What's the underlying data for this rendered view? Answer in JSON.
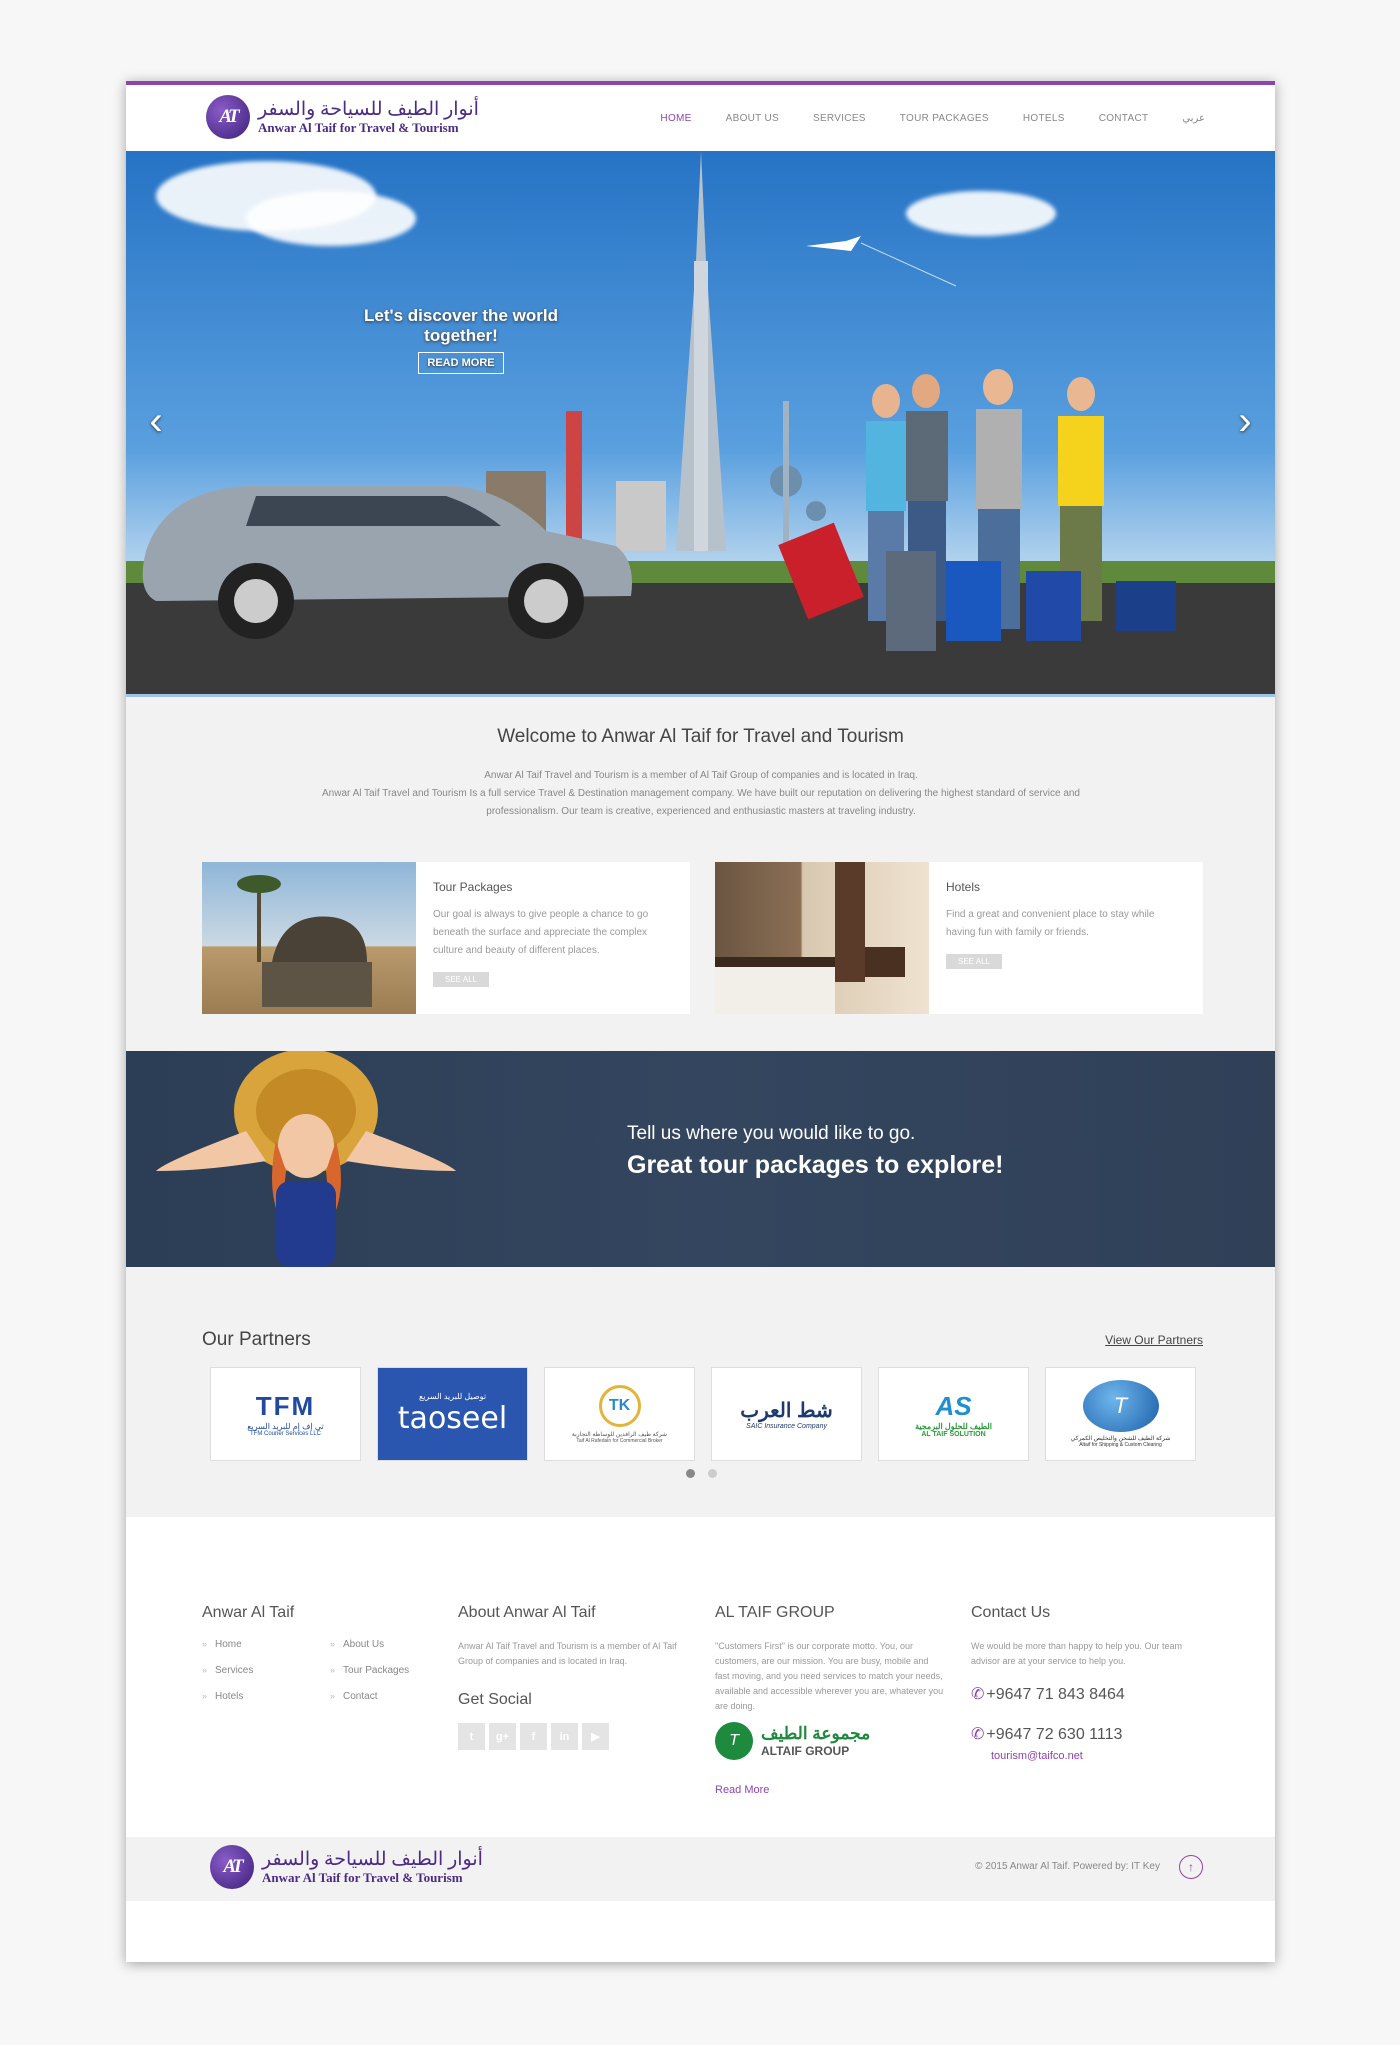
{
  "header": {
    "logo_initials": "AT",
    "logo_arabic": "أنوار الطيف للسياحة والسفر",
    "logo_english": "Anwar Al Taif for Travel & Tourism",
    "nav": [
      "HOME",
      "ABOUT US",
      "SERVICES",
      "TOUR PACKAGES",
      "HOTELS",
      "CONTACT",
      "عربي"
    ]
  },
  "hero": {
    "caption": "Let's discover the world together!",
    "button": "READ MORE",
    "prev_icon": "‹",
    "next_icon": "›"
  },
  "welcome": {
    "title": "Welcome to Anwar Al Taif for Travel and Tourism",
    "line1": "Anwar Al Taif Travel and Tourism is a member of Al Taif Group of companies and is located in Iraq.",
    "line2": "Anwar Al Taif Travel and Tourism Is a full service Travel & Destination management company. We have built our reputation on delivering the highest standard of service and professionalism. Our team is creative, experienced and enthusiastic masters at traveling industry."
  },
  "cards": [
    {
      "title": "Tour Packages",
      "desc": "Our goal is always to give people a chance to go beneath the surface and appreciate the complex culture and beauty of different places.",
      "button": "SEE ALL"
    },
    {
      "title": "Hotels",
      "desc": "Find a great and convenient place to stay while having fun with family or friends.",
      "button": "SEE ALL"
    }
  ],
  "banner": {
    "line1": "Tell us where you would like to go.",
    "line2": "Great tour packages to explore!"
  },
  "partners": {
    "title": "Our Partners",
    "link": "View Our Partners",
    "logos": [
      {
        "name": "TFM",
        "sub_ar": "تي إف إم للبريد السريع",
        "sub_en": "TFM Courier Services LLC"
      },
      {
        "name": "taoseel",
        "sub_ar": "توصيل للبريد السريع",
        "sub_en": ""
      },
      {
        "name": "TK",
        "sub_ar": "شركة طيف الرافدين للوساطة التجارية",
        "sub_en": "Taif Al Rafedain for Commercial Broker"
      },
      {
        "name": "شط العرب",
        "sub_ar": "",
        "sub_en": "SAIC Insurance Company"
      },
      {
        "name": "AS",
        "sub_ar": "الطيف للحلول البرمجية",
        "sub_en": "AL TAIF SOLUTION"
      },
      {
        "name": "T",
        "sub_ar": "شركة الطيف للشحن والتخليص الكمركي",
        "sub_en": "Altaif for Shipping & Custom Clearing"
      }
    ]
  },
  "footer": {
    "col1": {
      "title": "Anwar Al Taif",
      "links": [
        "Home",
        "About Us",
        "Services",
        "Tour Packages",
        "Hotels",
        "Contact"
      ]
    },
    "col2": {
      "title": "About Anwar Al Taif",
      "text": "Anwar Al Taif Travel and Tourism is a member of Al Taif Group of companies and is located in Iraq.",
      "social_title": "Get Social",
      "social": [
        "t",
        "g+",
        "f",
        "in",
        "▶"
      ]
    },
    "col3": {
      "title": "AL TAIF GROUP",
      "text": "\"Customers First\" is our corporate motto. You, our customers, are our mission. You are busy, mobile and fast moving, and you need services to match your needs, available and accessible wherever you are, whatever you are doing.",
      "group_ar": "مجموعة الطيف",
      "group_en": "ALTAIF GROUP",
      "read_more": "Read More"
    },
    "col4": {
      "title": "Contact Us",
      "text": "We would be more than happy to help you. Our team advisor are at your service to help you.",
      "phone1": "+9647 71 843 8464",
      "phone2": "+9647 72 630 1113",
      "email": "tourism@taifco.net"
    },
    "copyright": "© 2015 Anwar Al Taif. Powered by: IT Key",
    "totop": "↑"
  },
  "colors": {
    "accent": "#8e44ad",
    "banner": "#2c3e55",
    "hero_sky": "#2673c5"
  }
}
